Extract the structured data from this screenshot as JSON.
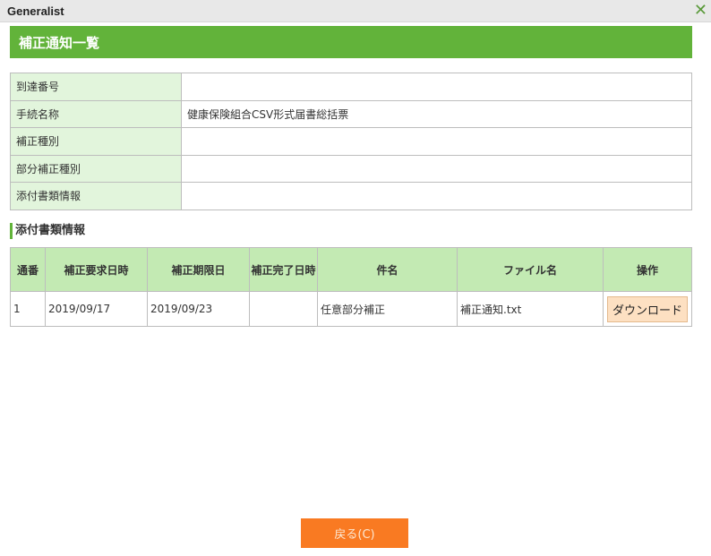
{
  "window": {
    "title": "Generalist"
  },
  "header": {
    "title": "補正通知一覧"
  },
  "info": [
    {
      "label": "到達番号",
      "value": ""
    },
    {
      "label": "手続名称",
      "value": "健康保険組合CSV形式届書総括票"
    },
    {
      "label": "補正種別",
      "value": ""
    },
    {
      "label": "部分補正種別",
      "value": ""
    },
    {
      "label": "添付書類情報",
      "value": ""
    }
  ],
  "section": {
    "title": "添付書類情報"
  },
  "table": {
    "columns": [
      "通番",
      "補正要求日時",
      "補正期限日",
      "補正完了日時",
      "件名",
      "ファイル名",
      "操作"
    ],
    "rows": [
      {
        "no": "1",
        "request": "2019/09/17",
        "deadline": "2019/09/23",
        "completed": "",
        "subject": "任意部分補正",
        "file": "補正通知.txt",
        "action": "ダウンロード"
      }
    ]
  },
  "footer": {
    "back_label": "戻る(C)"
  }
}
